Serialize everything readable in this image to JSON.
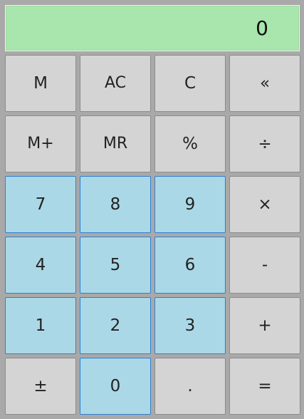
{
  "display": {
    "value": "0"
  },
  "keys": {
    "m": "M",
    "ac": "AC",
    "c": "C",
    "backspace": "«",
    "m_plus": "M+",
    "mr": "MR",
    "percent": "%",
    "divide": "÷",
    "seven": "7",
    "eight": "8",
    "nine": "9",
    "multiply": "×",
    "four": "4",
    "five": "5",
    "six": "6",
    "minus": "-",
    "one": "1",
    "two": "2",
    "three": "3",
    "plus": "+",
    "plus_minus": "±",
    "zero": "0",
    "decimal": ".",
    "equals": "="
  },
  "colors": {
    "display_bg": "#a8e6ad",
    "operator_key": "#d4d4d4",
    "digit_key": "#abd8e6",
    "digit_border": "#2f7fd1",
    "frame": "#a9a9a9"
  }
}
